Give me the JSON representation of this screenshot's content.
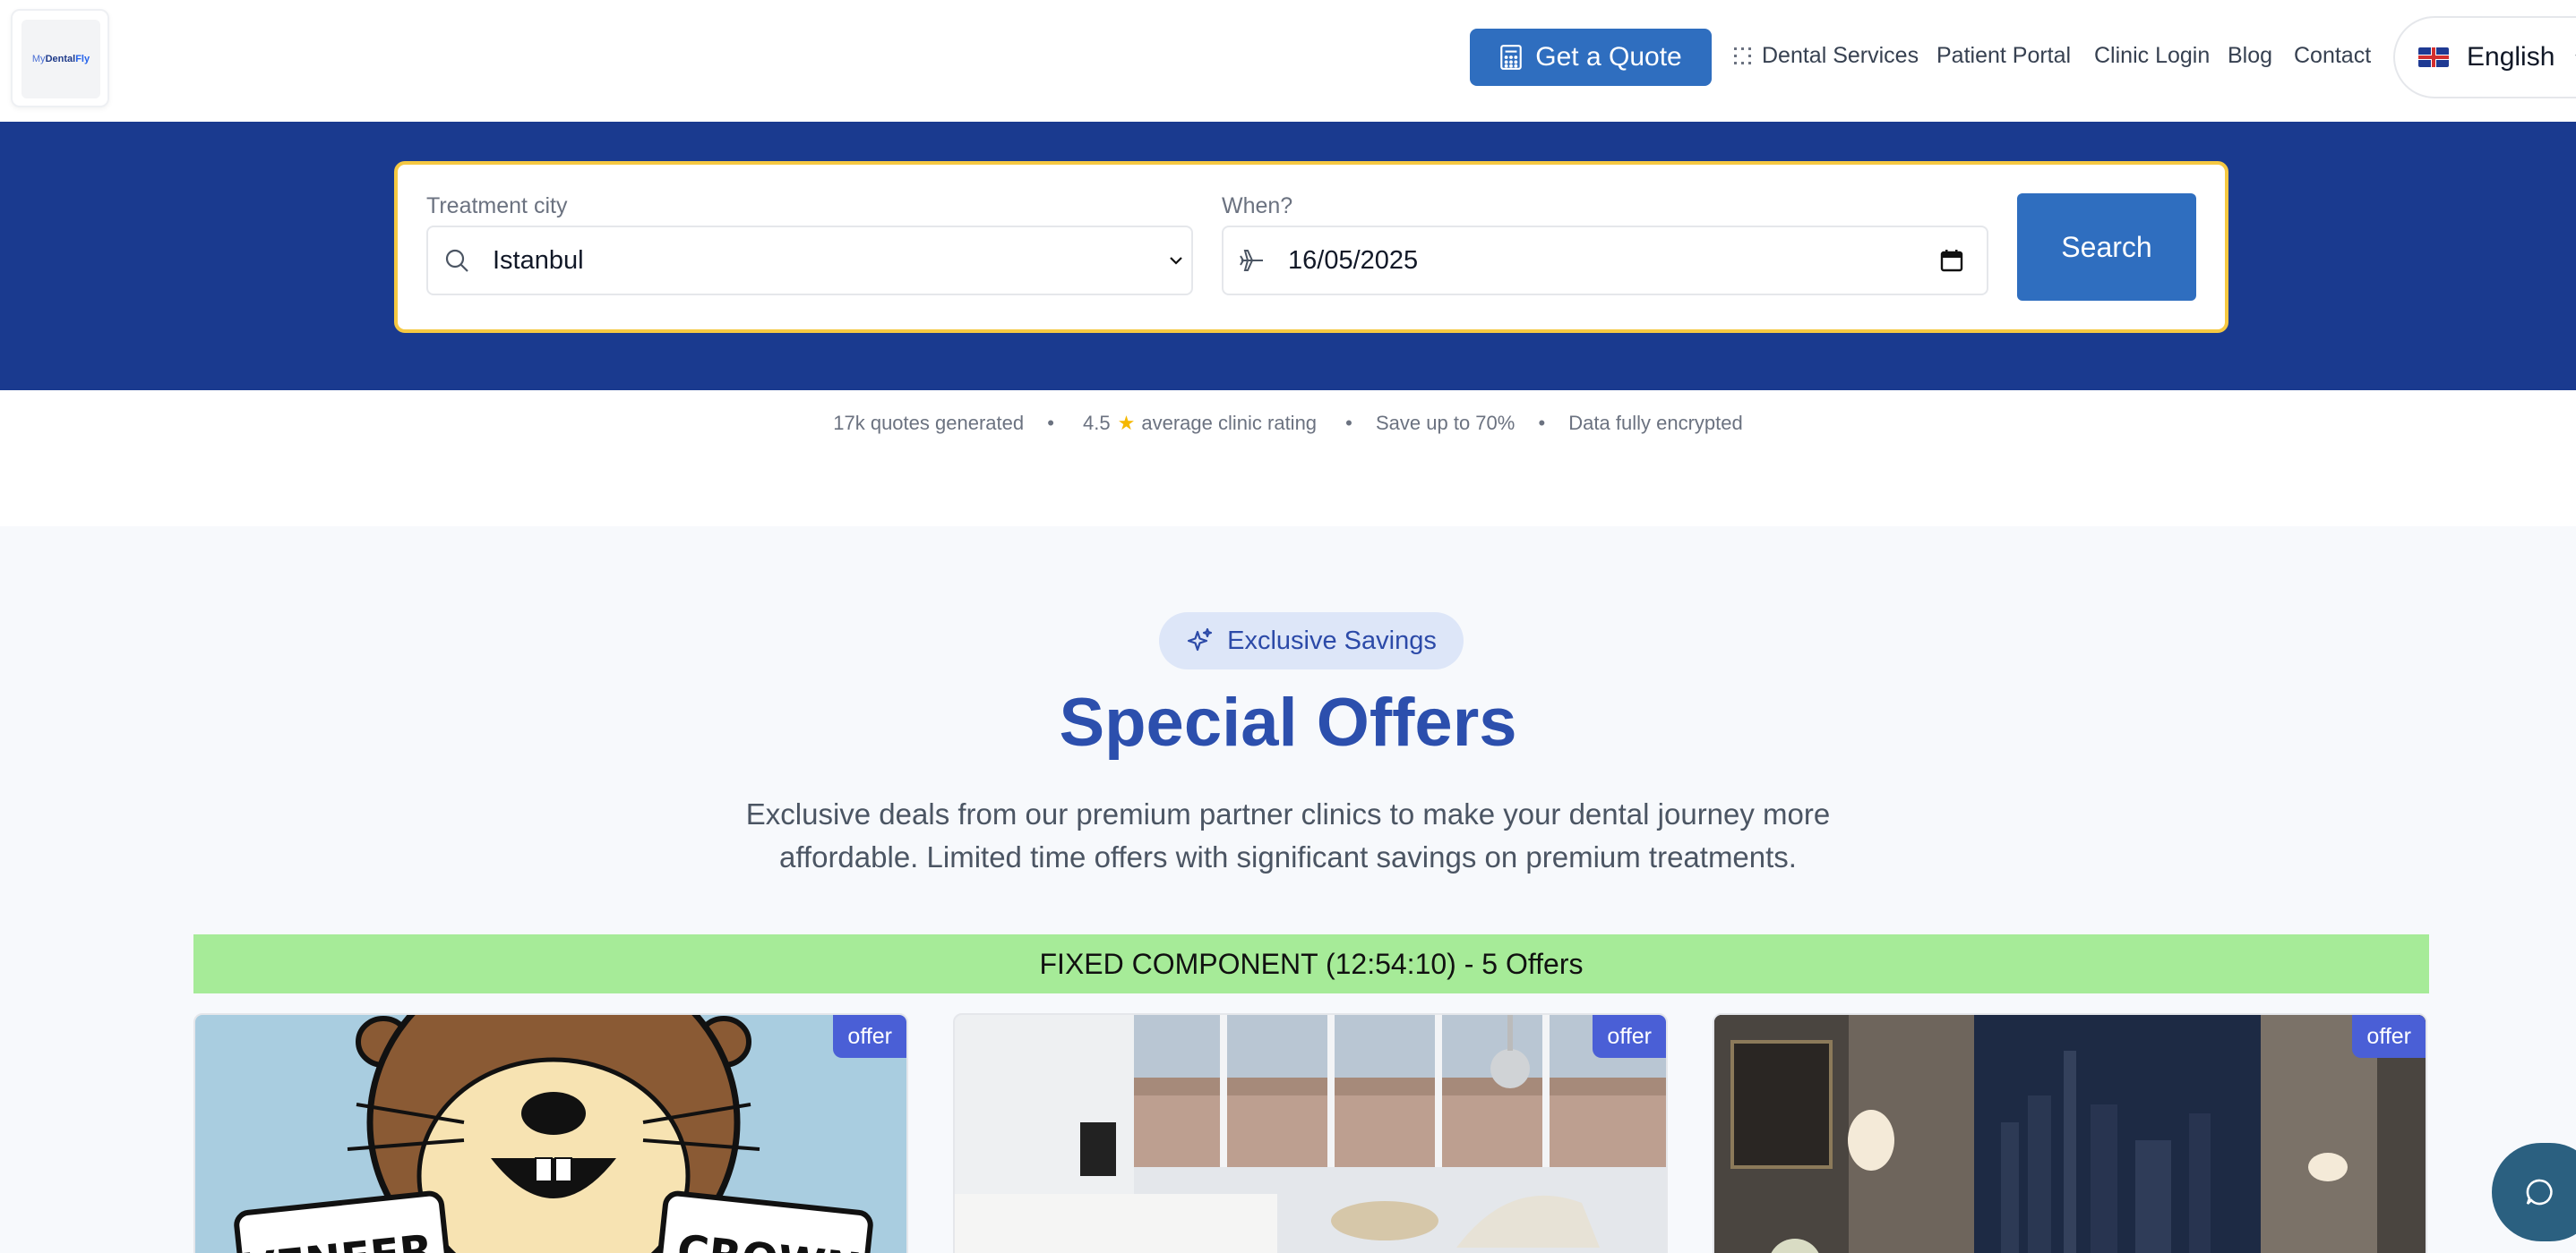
{
  "header": {
    "logo_text_1": "My",
    "logo_text_2": "Dental",
    "logo_text_3": "Fly",
    "quote_button": "Get a Quote",
    "nav": {
      "services": "Dental Services",
      "portal": "Patient Portal",
      "clinic_login": "Clinic Login",
      "blog": "Blog",
      "contact": "Contact"
    },
    "language": "English"
  },
  "search": {
    "city_label": "Treatment city",
    "city_value": "Istanbul",
    "when_label": "When?",
    "when_value": "16/05/2025",
    "button": "Search"
  },
  "stats": {
    "quotes": "17k quotes generated",
    "rating_value": "4.5",
    "rating_text": "average clinic rating",
    "save": "Save up to 70%",
    "encrypted": "Data fully encrypted",
    "separator": "•"
  },
  "offers": {
    "pill": "Exclusive Savings",
    "title": "Special Offers",
    "description": "Exclusive deals from our premium partner clinics to make your dental journey more affordable. Limited time offers with significant savings on premium treatments.",
    "fixed_bar": "FIXED COMPONENT (12:54:10) - 5 Offers",
    "cards": [
      {
        "badge": "offer",
        "sign_left": "VENEER",
        "sign_right": "CROWN"
      },
      {
        "badge": "offer"
      },
      {
        "badge": "offer"
      }
    ]
  },
  "colors": {
    "primary": "#2f6ebf",
    "band": "#1a3a8f",
    "title": "#2c4fad",
    "highlight_border": "#f5c842",
    "fixed_bar": "#a6eb98"
  }
}
